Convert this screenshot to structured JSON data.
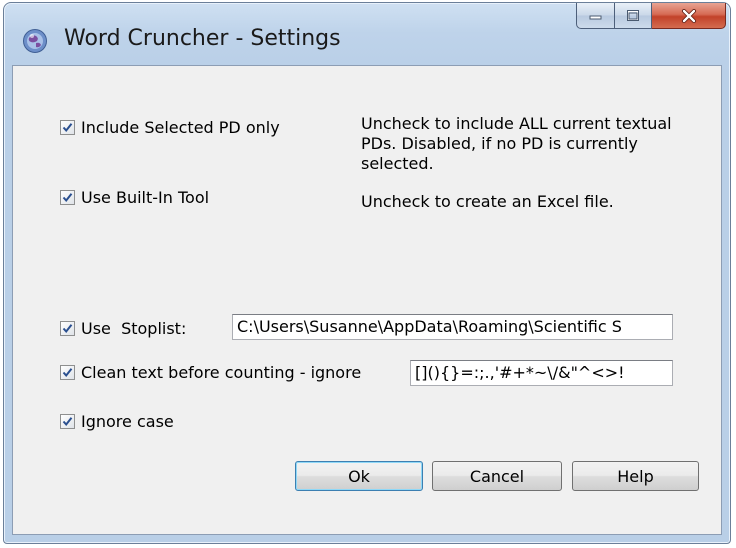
{
  "window": {
    "title": "Word Cruncher - Settings"
  },
  "options": {
    "include_selected": {
      "label": "Include Selected PD only",
      "checked": true,
      "help": "Uncheck to include ALL current textual PDs. Disabled, if no PD is currently selected."
    },
    "built_in_tool": {
      "label": "Use Built-In Tool",
      "checked": true,
      "help": "Uncheck to create an Excel file."
    },
    "stoplist": {
      "label": "Use  Stoplist:",
      "checked": true,
      "path_value": "C:\\Users\\Susanne\\AppData\\Roaming\\Scientific S"
    },
    "clean_text": {
      "label": "Clean text before counting - ignore",
      "checked": true,
      "chars_value": "[](){}=:;.,'#+*~\\/&\"^<>!"
    },
    "ignore_case": {
      "label": "Ignore case",
      "checked": true
    }
  },
  "buttons": {
    "ok": "Ok",
    "cancel": "Cancel",
    "help": "Help"
  },
  "colors": {
    "frame": "#b9cfe7",
    "client": "#f0f0f0",
    "close_red": "#c2422a",
    "check_blue": "#2a4f8f",
    "default_button": "#3c7fb1"
  }
}
